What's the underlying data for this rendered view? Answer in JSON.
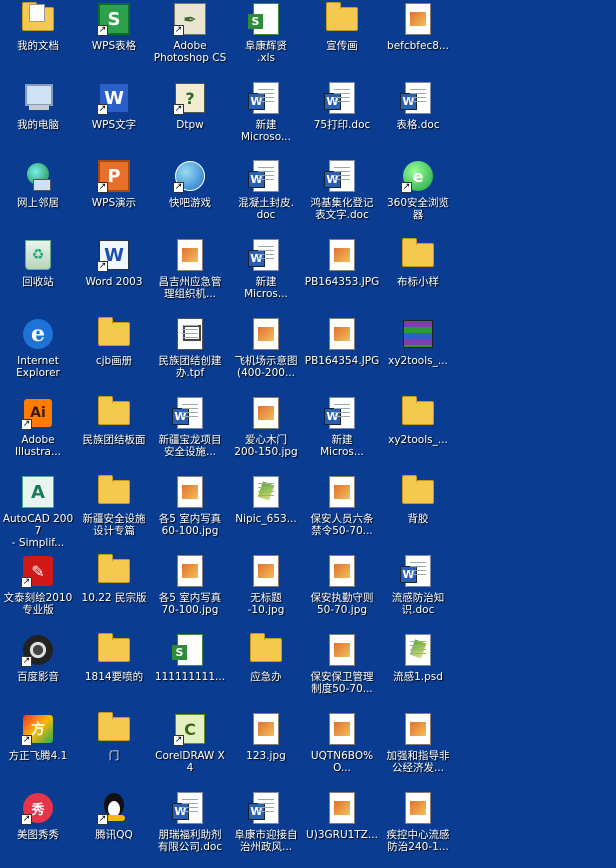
{
  "desktop": {
    "background_color": "#0a3d91",
    "icons": [
      {
        "name": "my-documents-icon",
        "label": "我的文档",
        "kind": "folder-docs",
        "col": 0,
        "row": 0
      },
      {
        "name": "my-computer-icon",
        "label": "我的电脑",
        "kind": "computer",
        "col": 0,
        "row": 1
      },
      {
        "name": "network-places-icon",
        "label": "网上邻居",
        "kind": "network",
        "col": 0,
        "row": 2
      },
      {
        "name": "recycle-bin-icon",
        "label": "回收站",
        "kind": "recycle",
        "col": 0,
        "row": 3
      },
      {
        "name": "internet-explorer-icon",
        "label": "Internet\nExplorer",
        "kind": "ie",
        "col": 0,
        "row": 4
      },
      {
        "name": "adobe-illustrator-icon",
        "label": "Adobe\nIllustra...",
        "kind": "ai",
        "col": 0,
        "row": 5,
        "shortcut": true
      },
      {
        "name": "autocad-icon",
        "label": "AutoCAD 2007\n- Simplif...",
        "kind": "autocad",
        "col": 0,
        "row": 6
      },
      {
        "name": "wentai-carving-icon",
        "label": "文泰刻绘2010\n专业版",
        "kind": "wentai",
        "col": 0,
        "row": 7,
        "shortcut": true
      },
      {
        "name": "baidu-player-icon",
        "label": "百度影音",
        "kind": "baidu",
        "col": 0,
        "row": 8,
        "shortcut": true
      },
      {
        "name": "founder-feiteng-icon",
        "label": "方正飞腾4.1",
        "kind": "founder",
        "col": 0,
        "row": 9,
        "shortcut": true
      },
      {
        "name": "meitu-icon",
        "label": "美图秀秀",
        "kind": "meitu",
        "col": 0,
        "row": 10,
        "shortcut": true
      },
      {
        "name": "wps-spreadsheet-icon",
        "label": "WPS表格",
        "kind": "wps-s",
        "col": 1,
        "row": 0,
        "shortcut": true
      },
      {
        "name": "wps-writer-icon",
        "label": "WPS文字",
        "kind": "wps-w",
        "col": 1,
        "row": 1,
        "shortcut": true
      },
      {
        "name": "wps-presentation-icon",
        "label": "WPS演示",
        "kind": "wps-p",
        "col": 1,
        "row": 2,
        "shortcut": true
      },
      {
        "name": "word-2003-icon",
        "label": "Word 2003",
        "kind": "word",
        "col": 1,
        "row": 3,
        "shortcut": true
      },
      {
        "name": "cjb-folder-icon",
        "label": "cjb画册",
        "kind": "folder",
        "col": 1,
        "row": 4
      },
      {
        "name": "minzu-board-folder-icon",
        "label": "民族团结板面",
        "kind": "folder",
        "col": 1,
        "row": 5
      },
      {
        "name": "xinjiang-safety-folder-icon",
        "label": "新疆安全设施\n设计专篇",
        "kind": "folder",
        "col": 1,
        "row": 6
      },
      {
        "name": "minzong-folder-icon",
        "label": "10.22 民宗版",
        "kind": "folder",
        "col": 1,
        "row": 7
      },
      {
        "name": "spray-1814-folder-icon",
        "label": "1814要喷的",
        "kind": "folder",
        "col": 1,
        "row": 8
      },
      {
        "name": "door-folder-icon",
        "label": "门",
        "kind": "folder",
        "col": 1,
        "row": 9
      },
      {
        "name": "tencent-qq-icon",
        "label": "腾讯QQ",
        "kind": "qq",
        "col": 1,
        "row": 10,
        "shortcut": true
      },
      {
        "name": "photoshop-icon",
        "label": "Adobe\nPhotoshop CS",
        "kind": "photoshop",
        "col": 2,
        "row": 0,
        "shortcut": true
      },
      {
        "name": "dtpw-icon",
        "label": "Dtpw",
        "kind": "dtpw",
        "col": 2,
        "row": 1,
        "shortcut": true
      },
      {
        "name": "kuaiba-game-icon",
        "label": "快吧游戏",
        "kind": "kuaiba",
        "col": 2,
        "row": 2,
        "shortcut": true
      },
      {
        "name": "changji-emergency-file-icon",
        "label": "昌吉州应急管\n理组织机...",
        "kind": "image",
        "col": 2,
        "row": 3
      },
      {
        "name": "minzu-tpf-file-icon",
        "label": "民族团结创建\n办.tpf",
        "kind": "tpf",
        "col": 2,
        "row": 4
      },
      {
        "name": "xinjiang-baolong-doc-icon",
        "label": "新疆宝龙项目\n安全设施...",
        "kind": "word-doc",
        "col": 2,
        "row": 5
      },
      {
        "name": "indoor-photo-60-file-icon",
        "label": "各5 室内写真\n60-100.jpg",
        "kind": "image",
        "col": 2,
        "row": 6
      },
      {
        "name": "indoor-photo-70-file-icon",
        "label": "各5 室内写真\n70-100.jpg",
        "kind": "image",
        "col": 2,
        "row": 7
      },
      {
        "name": "xls-111-file-icon",
        "label": "111111111...",
        "kind": "xls",
        "col": 2,
        "row": 8
      },
      {
        "name": "coreldraw-icon",
        "label": "CorelDRAW X4",
        "kind": "corel",
        "col": 2,
        "row": 9,
        "shortcut": true
      },
      {
        "name": "pengruifu-doc-icon",
        "label": "朋瑞福利助剂\n有限公司.doc",
        "kind": "word-doc",
        "col": 2,
        "row": 10
      },
      {
        "name": "fukang-xls-file-icon",
        "label": "阜康辉贤\n.xls",
        "kind": "xls",
        "col": 3,
        "row": 0
      },
      {
        "name": "new-microsoft-doc-1-icon",
        "label": "新建\nMicroso...",
        "kind": "word-doc",
        "col": 3,
        "row": 1
      },
      {
        "name": "concrete-cover-doc-icon",
        "label": "混凝土封皮.\ndoc",
        "kind": "word-doc",
        "col": 3,
        "row": 2
      },
      {
        "name": "new-microsoft-doc-2-icon",
        "label": "新建\nMicros...",
        "kind": "word-doc",
        "col": 3,
        "row": 3
      },
      {
        "name": "airport-diagram-file-icon",
        "label": "飞机场示意图\n(400-200...",
        "kind": "image",
        "col": 3,
        "row": 4
      },
      {
        "name": "aixin-gate-file-icon",
        "label": "爱心木门\n200-150.jpg",
        "kind": "image",
        "col": 3,
        "row": 5
      },
      {
        "name": "nipic-file-icon",
        "label": "Nipic_653...",
        "kind": "psd",
        "col": 3,
        "row": 6
      },
      {
        "name": "untitled-file-icon",
        "label": "无标题\n-10.jpg",
        "kind": "image",
        "col": 3,
        "row": 7
      },
      {
        "name": "emergency-office-folder-icon",
        "label": "应急办",
        "kind": "folder",
        "col": 3,
        "row": 8
      },
      {
        "name": "jpg-123-file-icon",
        "label": "123.jpg",
        "kind": "image",
        "col": 3,
        "row": 9
      },
      {
        "name": "fukang-city-doc-icon",
        "label": "阜康市迎接自\n治州政风...",
        "kind": "word-doc",
        "col": 3,
        "row": 10
      },
      {
        "name": "promo-folder-icon",
        "label": "宣传画",
        "kind": "folder",
        "col": 4,
        "row": 0
      },
      {
        "name": "print75-doc-icon",
        "label": "75打印.doc",
        "kind": "word-doc",
        "col": 4,
        "row": 1
      },
      {
        "name": "hongji-doc-icon",
        "label": "鸿基集化登记\n表文字.doc",
        "kind": "word-doc",
        "col": 4,
        "row": 2
      },
      {
        "name": "pb164353-file-icon",
        "label": "PB164353.JPG",
        "kind": "image",
        "col": 4,
        "row": 3
      },
      {
        "name": "pb164354-file-icon",
        "label": "PB164354.JPG",
        "kind": "image",
        "col": 4,
        "row": 4
      },
      {
        "name": "new-microsoft-doc-3-icon",
        "label": "新建\nMicros...",
        "kind": "word-doc",
        "col": 4,
        "row": 5
      },
      {
        "name": "security-six-rules-file-icon",
        "label": "保安人员六条\n禁令50-70...",
        "kind": "image",
        "col": 4,
        "row": 6
      },
      {
        "name": "security-duty-file-icon",
        "label": "保安执勤守则\n50-70.jpg",
        "kind": "image",
        "col": 4,
        "row": 7
      },
      {
        "name": "security-mgmt-file-icon",
        "label": "保安保卫管理\n制度50-70...",
        "kind": "image",
        "col": 4,
        "row": 8
      },
      {
        "name": "uqtn-file-icon",
        "label": "UQTN6BO%O...",
        "kind": "image",
        "col": 4,
        "row": 9
      },
      {
        "name": "u3gru1tz-file-icon",
        "label": "U)3GRU1TZ...",
        "kind": "image",
        "col": 4,
        "row": 10
      },
      {
        "name": "befcbfec-file-icon",
        "label": "befcbfec8...",
        "kind": "image",
        "col": 5,
        "row": 0
      },
      {
        "name": "form-doc-icon",
        "label": "表格.doc",
        "kind": "word-doc",
        "col": 5,
        "row": 1
      },
      {
        "name": "browser-360-icon",
        "label": "360安全浏览\n器",
        "kind": "360",
        "col": 5,
        "row": 2,
        "shortcut": true
      },
      {
        "name": "cloth-sample-folder-icon",
        "label": "布标小样",
        "kind": "folder",
        "col": 5,
        "row": 3
      },
      {
        "name": "xy2tools-1-icon",
        "label": "xy2tools_...",
        "kind": "winrar",
        "col": 5,
        "row": 4
      },
      {
        "name": "xy2tools-2-folder-icon",
        "label": "xy2tools_...",
        "kind": "folder",
        "col": 5,
        "row": 5
      },
      {
        "name": "beijiao-folder-icon",
        "label": "背胶",
        "kind": "folder",
        "col": 5,
        "row": 6
      },
      {
        "name": "flu-prevention-doc-icon",
        "label": "流感防治知\n识.doc",
        "kind": "word-doc",
        "col": 5,
        "row": 7
      },
      {
        "name": "flu-psd-file-icon",
        "label": "流感1.psd",
        "kind": "psd",
        "col": 5,
        "row": 8
      },
      {
        "name": "strengthen-guide-file-icon",
        "label": "加强和指导非\n公经济发...",
        "kind": "image",
        "col": 5,
        "row": 9
      },
      {
        "name": "cdc-flu-file-icon",
        "label": "疾控中心流感\n防治240-1...",
        "kind": "image",
        "col": 5,
        "row": 10
      }
    ]
  }
}
